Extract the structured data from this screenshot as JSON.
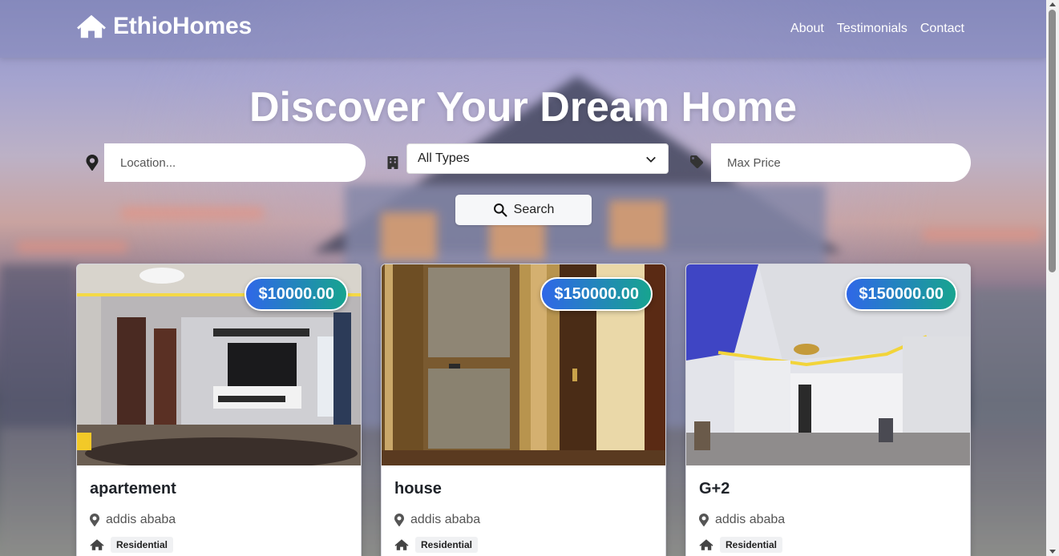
{
  "brand": {
    "name": "EthioHomes",
    "icon": "house-icon"
  },
  "nav": {
    "links": [
      "About",
      "Testimonials",
      "Contact"
    ]
  },
  "hero": {
    "title": "Discover Your Dream Home"
  },
  "search": {
    "location_placeholder": "Location...",
    "type_selected": "All Types",
    "price_placeholder": "Max Price",
    "button_label": "Search"
  },
  "colors": {
    "badge_start": "#2f67e8",
    "badge_end": "#17a48f",
    "title_text": "#1f2329"
  },
  "listings": [
    {
      "price": "$10000.00",
      "title": "apartement",
      "location": "addis ababa",
      "type": "Residential"
    },
    {
      "price": "$150000.00",
      "title": "house",
      "location": "addis ababa",
      "type": "Residential"
    },
    {
      "price": "$150000.00",
      "title": "G+2",
      "location": "addis ababa",
      "type": "Residential"
    }
  ]
}
